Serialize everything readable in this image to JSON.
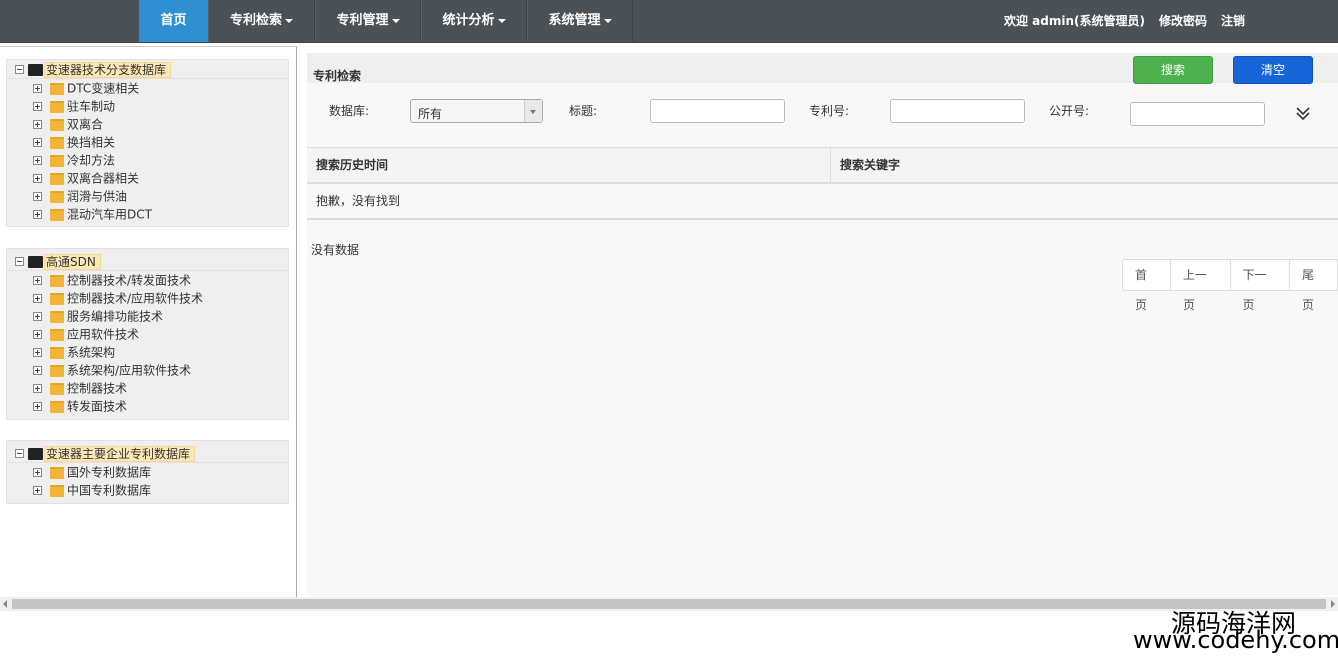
{
  "nav": {
    "items": [
      {
        "label": "首页",
        "dropdown": false,
        "active": true
      },
      {
        "label": "专利检索",
        "dropdown": true,
        "active": false
      },
      {
        "label": "专利管理",
        "dropdown": true,
        "active": false
      },
      {
        "label": "统计分析",
        "dropdown": true,
        "active": false
      },
      {
        "label": "系统管理",
        "dropdown": true,
        "active": false
      }
    ],
    "welcome": "欢迎 admin(系统管理员)",
    "change_password": "修改密码",
    "logout": "注销"
  },
  "trees": [
    {
      "root": "变速器技术分支数据库",
      "items": [
        "DTC变速相关",
        "驻车制动",
        "双离合",
        "换挡相关",
        "冷却方法",
        "双离合器相关",
        "润滑与供油",
        "混动汽车用DCT"
      ]
    },
    {
      "root": "高通SDN",
      "items": [
        "控制器技术/转发面技术",
        "控制器技术/应用软件技术",
        "服务编排功能技术",
        "应用软件技术",
        "系统架构",
        "系统架构/应用软件技术",
        "控制器技术",
        "转发面技术"
      ]
    },
    {
      "root": "变速器主要企业专利数据库",
      "items": [
        "国外专利数据库",
        "中国专利数据库"
      ]
    }
  ],
  "search": {
    "title": "专利检索",
    "search_button": "搜索",
    "clear_button": "清空",
    "database_label": "数据库:",
    "database_value": "所有",
    "title_label": "标题:",
    "patent_no_label": "专利号:",
    "publication_no_label": "公开号:"
  },
  "history_table": {
    "col1": "搜索历史时间",
    "col2": "搜索关键字",
    "empty_message": "抱歉，没有找到"
  },
  "results": {
    "no_data": "没有数据"
  },
  "pager": {
    "first": "首页",
    "prev": "上一页",
    "next": "下一页",
    "last": "尾页"
  },
  "watermark": {
    "line1": "源码海洋网",
    "line2": "www.codehy.com"
  },
  "colors": {
    "topbar": "#4a5157",
    "nav_active": "#2f8fd1",
    "search_button": "#4db24d",
    "clear_button": "#1565d8",
    "tree_root_highlight": "#fde7b4",
    "folder": "#f2b53a"
  }
}
